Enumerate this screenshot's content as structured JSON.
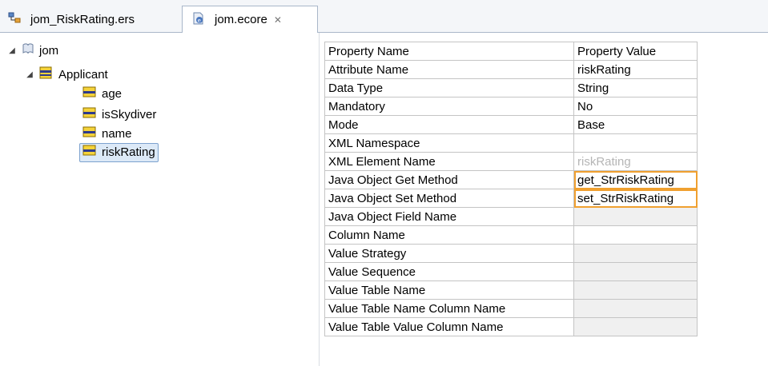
{
  "tabs": [
    {
      "label": "jom_RiskRating.ers",
      "icon": "ers-diagram-icon"
    },
    {
      "label": "jom.ecore",
      "icon": "ecore-file-icon",
      "close": "✕"
    }
  ],
  "tree": {
    "root": "jom",
    "class": "Applicant",
    "attributes": [
      "age",
      "isSkydiver",
      "name",
      "riskRating"
    ],
    "selected": "riskRating"
  },
  "table": {
    "headers": [
      "Property Name",
      "Property Value"
    ],
    "rows": [
      {
        "name": "Attribute Name",
        "value": "riskRating"
      },
      {
        "name": "Data Type",
        "value": "String"
      },
      {
        "name": "Mandatory",
        "value": "No"
      },
      {
        "name": "Mode",
        "value": "Base"
      },
      {
        "name": "XML Namespace",
        "value": ""
      },
      {
        "name": "XML Element Name",
        "value": "riskRating"
      },
      {
        "name": "Java Object Get Method",
        "value": "get_StrRiskRating"
      },
      {
        "name": "Java Object Set Method",
        "value": "set_StrRiskRating"
      },
      {
        "name": "Java Object Field Name",
        "value": ""
      },
      {
        "name": "Column Name",
        "value": ""
      },
      {
        "name": "Value Strategy",
        "value": ""
      },
      {
        "name": "Value Sequence",
        "value": ""
      },
      {
        "name": "Value Table Name",
        "value": ""
      },
      {
        "name": "Value Table Name Column Name",
        "value": ""
      },
      {
        "name": "Value Table Value Column Name",
        "value": ""
      }
    ]
  },
  "colors": {
    "highlight": "#f0a030",
    "tab_border": "#a9b7c9",
    "selection": "#dce9f7"
  }
}
